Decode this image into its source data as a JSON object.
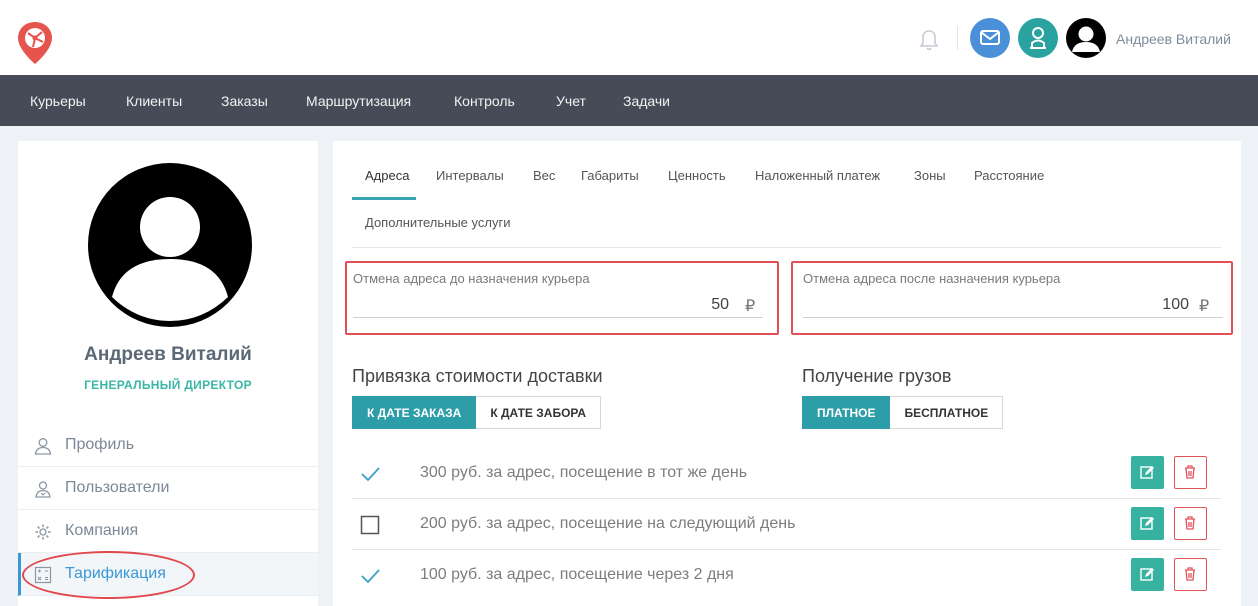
{
  "header": {
    "user_name": "Андреев Виталий",
    "icons": [
      "logo-icon",
      "bell-icon",
      "mail-icon",
      "support-icon",
      "avatar"
    ]
  },
  "nav": {
    "items": [
      {
        "label": "Курьеры"
      },
      {
        "label": "Клиенты"
      },
      {
        "label": "Заказы"
      },
      {
        "label": "Маршрутизация"
      },
      {
        "label": "Контроль"
      },
      {
        "label": "Учет"
      },
      {
        "label": "Задачи"
      }
    ]
  },
  "profile": {
    "name": "Андреев Виталий",
    "role": "ГЕНЕРАЛЬНЫЙ ДИРЕКТОР"
  },
  "sidebar": {
    "items": [
      {
        "label": "Профиль",
        "icon": "user-icon"
      },
      {
        "label": "Пользователи",
        "icon": "users-icon"
      },
      {
        "label": "Компания",
        "icon": "gear-icon"
      },
      {
        "label": "Тарификация",
        "icon": "calculator-icon",
        "active": true
      }
    ]
  },
  "tabs": {
    "items": [
      {
        "label": "Адреса",
        "active": true
      },
      {
        "label": "Интервалы"
      },
      {
        "label": "Вес"
      },
      {
        "label": "Габариты"
      },
      {
        "label": "Ценность"
      },
      {
        "label": "Наложенный платеж"
      },
      {
        "label": "Зоны"
      },
      {
        "label": "Расстояние"
      },
      {
        "label": "Дополнительные услуги"
      }
    ]
  },
  "fields": {
    "cancel_before": {
      "label": "Отмена адреса до назначения курьера",
      "value": "50",
      "currency": "₽"
    },
    "cancel_after": {
      "label": "Отмена адреса после назначения курьера",
      "value": "100",
      "currency": "₽"
    }
  },
  "pricing_binding": {
    "title": "Привязка стоимости доставки",
    "options": [
      "К ДАТЕ ЗАКАЗА",
      "К ДАТЕ ЗАБОРА"
    ],
    "selected": "К ДАТЕ ЗАКАЗА"
  },
  "cargo_receipt": {
    "title": "Получение грузов",
    "options": [
      "ПЛАТНОЕ",
      "БЕСПЛАТНОЕ"
    ],
    "selected": "ПЛАТНОЕ"
  },
  "rates": [
    {
      "text": "300 руб. за адрес, посещение в тот же день",
      "checked": true
    },
    {
      "text": "200 руб. за адрес, посещение на следующий день",
      "checked": false
    },
    {
      "text": "100 руб. за адрес, посещение через 2 дня",
      "checked": true
    }
  ],
  "colors": {
    "accent": "#2d9ea8",
    "nav_bg": "#464c57",
    "highlight": "#e0474c"
  }
}
